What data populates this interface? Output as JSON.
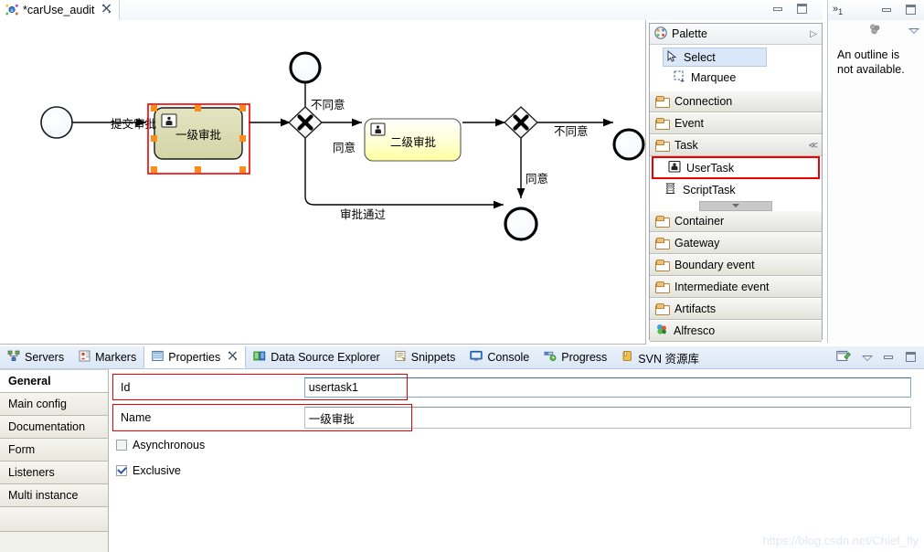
{
  "editor": {
    "tab_label": "*carUse_audit",
    "tab_icon": "activiti-diagram-icon",
    "close_icon": "close-icon",
    "window_minimize": "minimize-icon",
    "window_maximize": "maximize-icon"
  },
  "diagram": {
    "nodes": [
      {
        "id": "startevent1",
        "type": "start-event",
        "label": ""
      },
      {
        "id": "usertask1",
        "type": "user-task",
        "label": "一级审批",
        "selected": true
      },
      {
        "id": "exclusivegateway1",
        "type": "exclusive-gateway",
        "label": ""
      },
      {
        "id": "endevent1",
        "type": "end-event",
        "label": ""
      },
      {
        "id": "usertask2",
        "type": "user-task",
        "label": "二级审批",
        "selected": false
      },
      {
        "id": "exclusivegateway2",
        "type": "exclusive-gateway",
        "label": ""
      },
      {
        "id": "endevent2",
        "type": "end-event",
        "label": ""
      },
      {
        "id": "endevent3",
        "type": "end-event",
        "label": ""
      }
    ],
    "flow_labels": {
      "submit": "提交审批",
      "reject1": "不同意",
      "agree1": "同意",
      "approved": "审批通过",
      "reject2": "不同意",
      "agree2": "同意"
    }
  },
  "palette": {
    "title": "Palette",
    "title_icon": "palette-icon",
    "expand_icon": "chevron-right-icon",
    "tools": [
      {
        "label": "Select",
        "icon": "cursor-icon",
        "selected": true
      },
      {
        "label": "Marquee",
        "icon": "marquee-icon",
        "selected": false
      }
    ],
    "drawers_top": [
      {
        "label": "Connection",
        "icon": "folder-icon"
      },
      {
        "label": "Event",
        "icon": "folder-icon"
      }
    ],
    "task_drawer": {
      "label": "Task",
      "icon": "folder-icon",
      "collapse_icon": "collapse-all-icon"
    },
    "task_items": [
      {
        "label": "UserTask",
        "icon": "user-task-icon",
        "highlighted": true
      },
      {
        "label": "ScriptTask",
        "icon": "script-task-icon",
        "highlighted": false
      }
    ],
    "scroll_icon": "scroll-down-icon",
    "drawers_bottom": [
      {
        "label": "Container",
        "icon": "folder-icon"
      },
      {
        "label": "Gateway",
        "icon": "folder-icon"
      },
      {
        "label": "Boundary event",
        "icon": "folder-icon"
      },
      {
        "label": "Intermediate event",
        "icon": "folder-icon"
      },
      {
        "label": "Artifacts",
        "icon": "folder-icon"
      },
      {
        "label": "Alfresco",
        "icon": "alfresco-icon"
      }
    ]
  },
  "outline": {
    "restore_icon": "restore-icon",
    "count": "1",
    "minimize_icon": "minimize-icon",
    "maximize_icon": "maximize-icon",
    "view_menu_icon": "view-menu-icon",
    "outline_icon": "outline-icon",
    "message": "An outline is not available."
  },
  "bottom_view": {
    "tabs": [
      {
        "label": "Servers",
        "icon": "servers-icon",
        "active": false,
        "closable": false
      },
      {
        "label": "Markers",
        "icon": "markers-icon",
        "active": false,
        "closable": false
      },
      {
        "label": "Properties",
        "icon": "properties-icon",
        "active": true,
        "closable": true
      },
      {
        "label": "Data Source Explorer",
        "icon": "datasource-icon",
        "active": false,
        "closable": false
      },
      {
        "label": "Snippets",
        "icon": "snippets-icon",
        "active": false,
        "closable": false
      },
      {
        "label": "Console",
        "icon": "console-icon",
        "active": false,
        "closable": false
      },
      {
        "label": "Progress",
        "icon": "progress-icon",
        "active": false,
        "closable": false
      },
      {
        "label": "SVN 资源库",
        "icon": "svn-icon",
        "active": false,
        "closable": false
      }
    ],
    "close_glyph": "✕",
    "toolbar_icons": [
      {
        "name": "pin-view-icon"
      },
      {
        "name": "view-menu-icon"
      },
      {
        "name": "minimize-icon"
      },
      {
        "name": "maximize-icon"
      }
    ]
  },
  "properties": {
    "tabs": [
      {
        "label": "General",
        "active": true
      },
      {
        "label": "Main config",
        "active": false
      },
      {
        "label": "Documentation",
        "active": false
      },
      {
        "label": "Form",
        "active": false
      },
      {
        "label": "Listeners",
        "active": false
      },
      {
        "label": "Multi instance",
        "active": false
      }
    ],
    "fields": [
      {
        "label": "Id",
        "value": "usertask1",
        "focused": true
      },
      {
        "label": "Name",
        "value": "一级审批",
        "focused": false
      }
    ],
    "checkboxes": [
      {
        "label": "Asynchronous",
        "checked": false
      },
      {
        "label": "Exclusive",
        "checked": true
      }
    ]
  },
  "watermark": "https://blog.csdn.net/Chief_fly",
  "colors": {
    "selection_red": "#ee0000",
    "handle_orange": "#ff8c1a",
    "task_selected_fill": "#dcdcb4",
    "task_fill": "#ffffc8",
    "tab_active": "#ffffff"
  }
}
